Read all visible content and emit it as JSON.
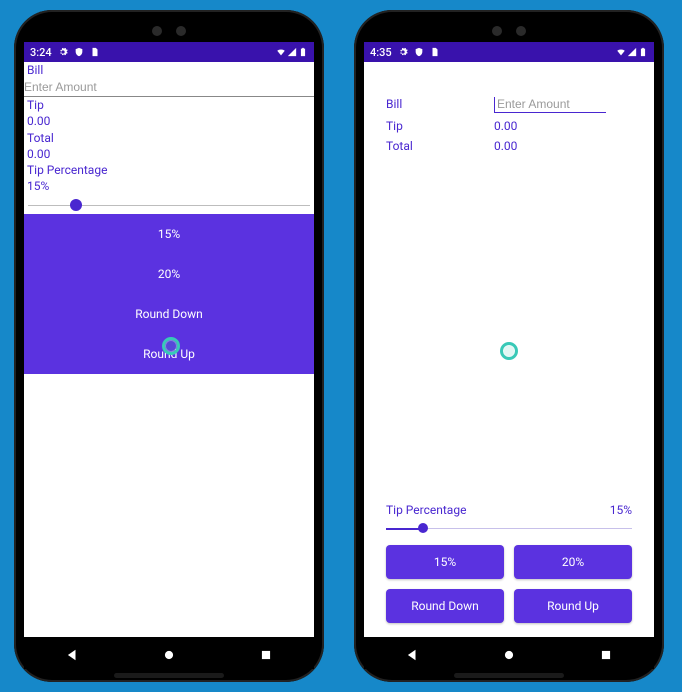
{
  "left": {
    "statusbar": {
      "time": "3:24"
    },
    "labels": {
      "bill": "Bill",
      "tip": "Tip",
      "total": "Total",
      "tip_percentage": "Tip Percentage"
    },
    "bill_placeholder": "Enter Amount",
    "tip_value": "0.00",
    "total_value": "0.00",
    "tip_percent_value": "15%",
    "slider_percent": 15,
    "buttons": {
      "b15": "15%",
      "b20": "20%",
      "round_down": "Round Down",
      "round_up": "Round Up"
    }
  },
  "right": {
    "statusbar": {
      "time": "4:35"
    },
    "labels": {
      "bill": "Bill",
      "tip": "Tip",
      "total": "Total",
      "tip_percentage": "Tip Percentage"
    },
    "bill_placeholder": "Enter Amount",
    "tip_value": "0.00",
    "total_value": "0.00",
    "tip_percent_value": "15%",
    "slider_percent": 15,
    "buttons": {
      "b15": "15%",
      "b20": "20%",
      "round_down": "Round Down",
      "round_up": "Round Up"
    }
  }
}
